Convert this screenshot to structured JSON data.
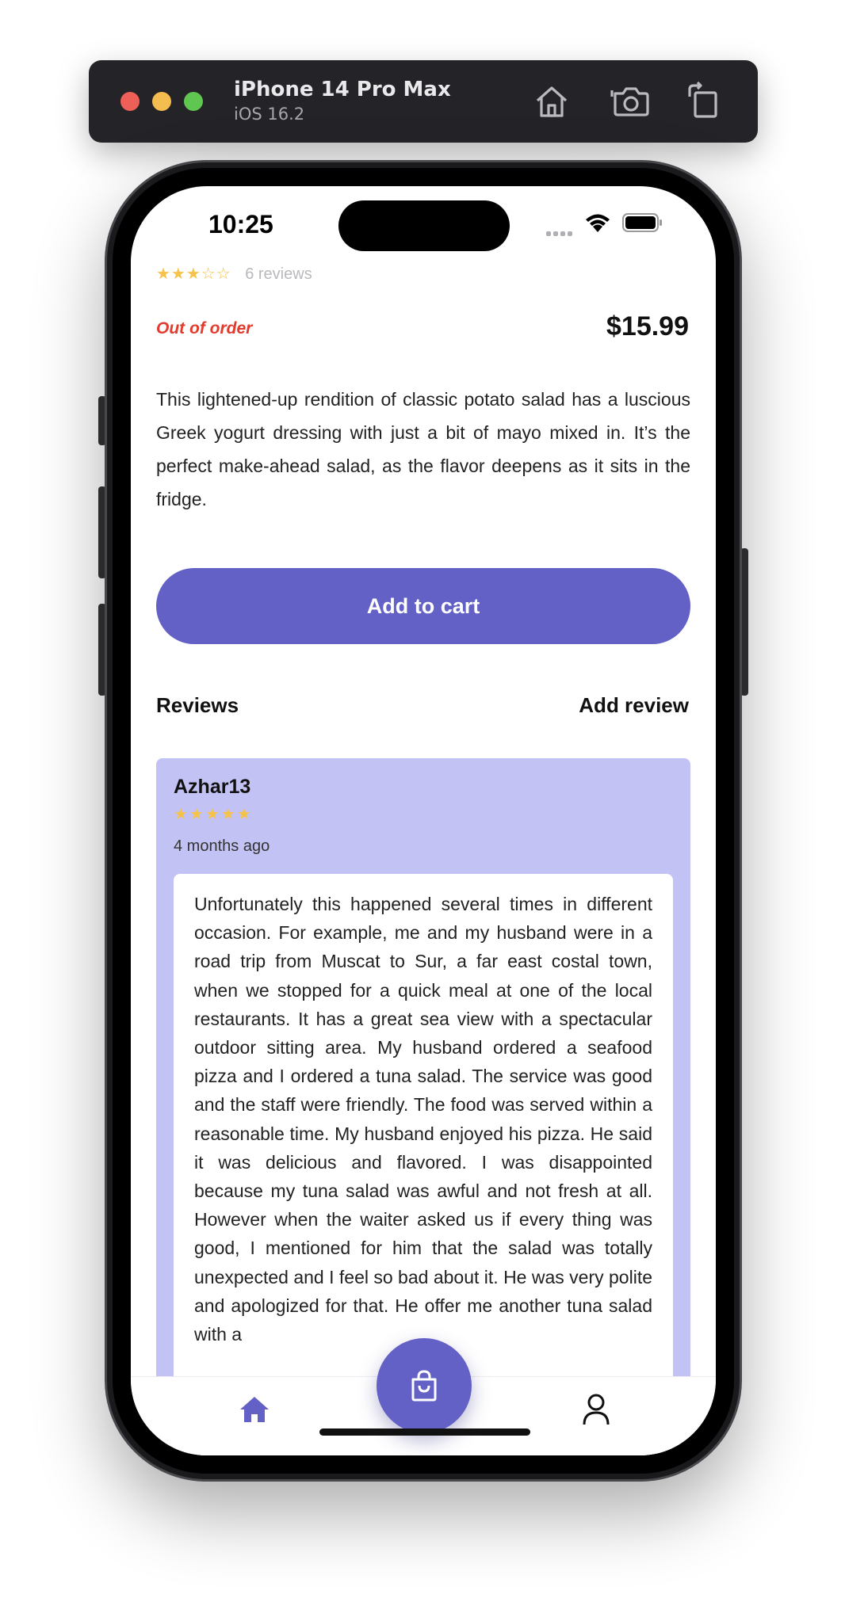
{
  "simulator": {
    "device_name": "iPhone 14 Pro Max",
    "os_version": "iOS 16.2",
    "buttons": [
      "home-icon",
      "screenshot-icon",
      "rotate-icon"
    ]
  },
  "status_bar": {
    "time": "10:25"
  },
  "product": {
    "stars_filled": 3,
    "stars_total": 5,
    "reviews_count_text": "6 reviews",
    "availability": "Out of order",
    "price": "$15.99",
    "description": "This lightened-up rendition of classic potato salad has a luscious Greek yogurt dressing with just a bit of mayo mixed in. It’s the perfect make-ahead salad, as the flavor deepens as it sits in the fridge.",
    "add_to_cart_label": "Add to cart"
  },
  "reviews_section": {
    "title": "Reviews",
    "add_review_label": "Add review",
    "items": [
      {
        "author": "Azhar13",
        "stars": 5,
        "time_ago": "4 months ago",
        "text": "Unfortunately this happened several times in different occasion. For example, me and my husband were in a road trip from Muscat to Sur, a far east costal town, when we stopped for a quick meal at one of the local restaurants. It has a great sea view with a spectacular outdoor sitting area. My husband ordered a seafood pizza and I ordered a tuna salad. The service was good and the staff were friendly. The food was served within a reasonable time. My husband enjoyed his pizza. He said it was delicious and flavored. I was disappointed because my tuna salad was awful and not fresh at all. However when the waiter asked us if every thing was good, I mentioned for him that the salad was totally unexpected and I feel so bad about it. He was very polite and apologized for that. He offer me another tuna salad with a"
      }
    ]
  },
  "tab_bar": {
    "items": [
      "home-icon",
      "cart-bag-icon",
      "profile-icon"
    ],
    "accent_color": "#6361c6"
  },
  "colors": {
    "accent": "#6361c6",
    "review_card_bg": "#c3c2f4",
    "star": "#f5c24a",
    "out_of_order": "#e23b2e"
  }
}
